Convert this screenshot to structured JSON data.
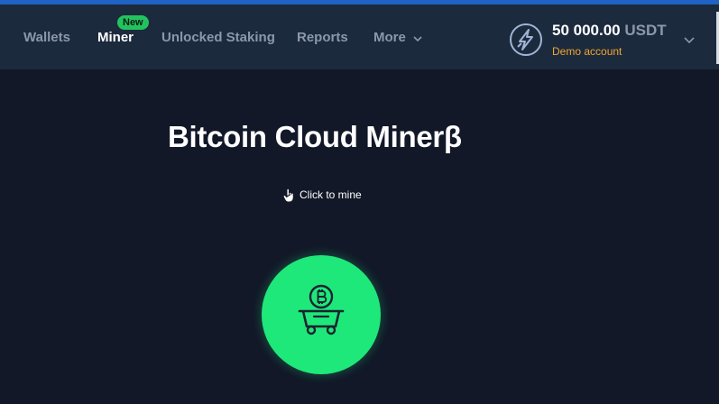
{
  "nav": {
    "items": [
      {
        "label": "Wallets"
      },
      {
        "label": "Miner",
        "badge": "New",
        "active": true
      },
      {
        "label": "Unlocked Staking"
      },
      {
        "label": "Reports"
      },
      {
        "label": "More",
        "icon": "chevron-down-icon"
      }
    ]
  },
  "account": {
    "amount": "50 000.00",
    "currency": "USDT",
    "label": "Demo account",
    "icon": "lightning-circle-icon"
  },
  "main": {
    "title": "Bitcoin Cloud Minerβ",
    "hint": "Click to mine",
    "hint_icon": "hand-pointer-icon",
    "mine_button_icon": "bitcoin-mine-cart-icon"
  },
  "colors": {
    "page_bg": "#121828",
    "nav_bg": "#1c2a3d",
    "accent_green": "#1ee87a",
    "badge_green": "#22c35e",
    "demo_orange": "#f2a531",
    "top_stripe": "#1f63c4"
  }
}
